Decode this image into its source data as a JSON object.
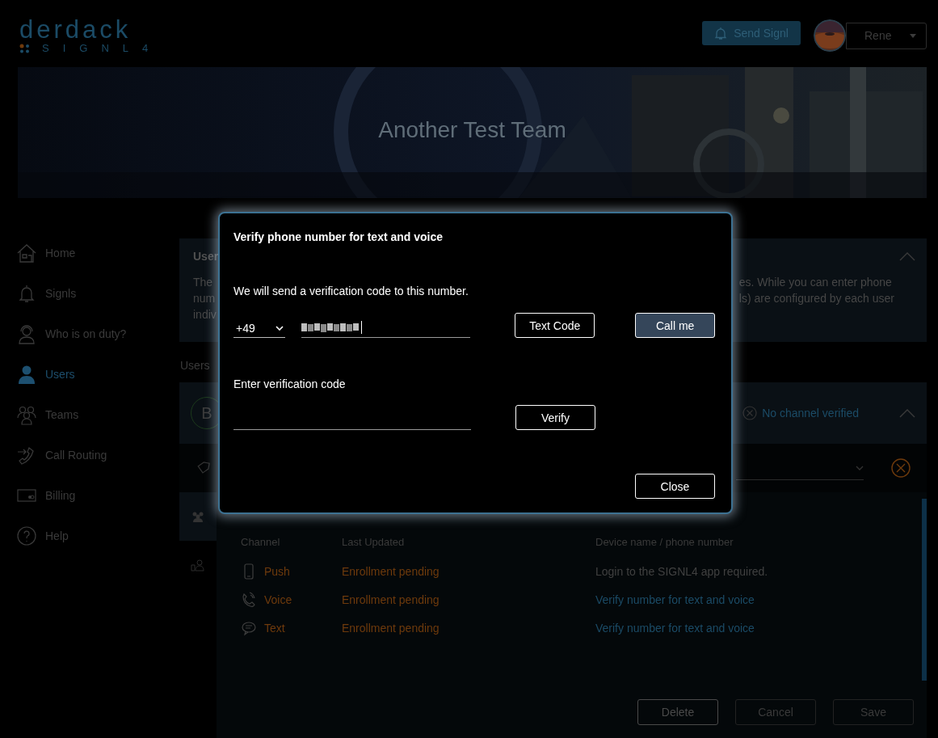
{
  "header": {
    "logo": {
      "wordmark": "derdack",
      "product": "SIGNL4"
    },
    "send_button": "Send Signl",
    "user": {
      "name": "Rene"
    }
  },
  "banner": {
    "title": "Another Test Team"
  },
  "sidebar": {
    "items": [
      {
        "label": "Home",
        "selected": false
      },
      {
        "label": "Signls",
        "selected": false
      },
      {
        "label": "Who is on duty?",
        "selected": false
      },
      {
        "label": "Users",
        "selected": true
      },
      {
        "label": "Teams",
        "selected": false
      },
      {
        "label": "Call Routing",
        "selected": false
      },
      {
        "label": "Billing",
        "selected": false
      },
      {
        "label": "Help",
        "selected": false
      }
    ]
  },
  "info_card": {
    "title": "User",
    "expanded": true,
    "left_lines": [
      "The",
      "num",
      "indiv"
    ],
    "right_lines": [
      "es. While you can enter phone",
      "ls) are configured by each user"
    ]
  },
  "users_heading": "Users",
  "user_row": {
    "avatar": "B",
    "status": "No channel verified",
    "expanded": true
  },
  "channels": {
    "columns": [
      "Channel",
      "Last Updated",
      "Device name / phone number"
    ],
    "rows": [
      {
        "kind": "push",
        "channel": "Push",
        "last_updated": "Enrollment pending",
        "device": "Login to the SIGNL4 app required.",
        "link": false
      },
      {
        "kind": "voice",
        "channel": "Voice",
        "last_updated": "Enrollment pending",
        "device": "Verify number for text and voice",
        "link": true
      },
      {
        "kind": "text",
        "channel": "Text",
        "last_updated": "Enrollment pending",
        "device": "Verify number for text and voice",
        "link": true
      }
    ]
  },
  "actions": [
    {
      "label": "Delete",
      "disabled": false
    },
    {
      "label": "Cancel",
      "disabled": true
    },
    {
      "label": "Save",
      "disabled": true
    }
  ],
  "modal": {
    "title": "Verify phone number for text and voice",
    "intro": "We will send a verification code to this number.",
    "country_code": "+49",
    "send_buttons": [
      {
        "label": "Text Code",
        "primary": false
      },
      {
        "label": "Call me",
        "primary": true
      }
    ],
    "code_label": "Enter verification code",
    "verify_button": "Verify",
    "close_button": "Close"
  }
}
